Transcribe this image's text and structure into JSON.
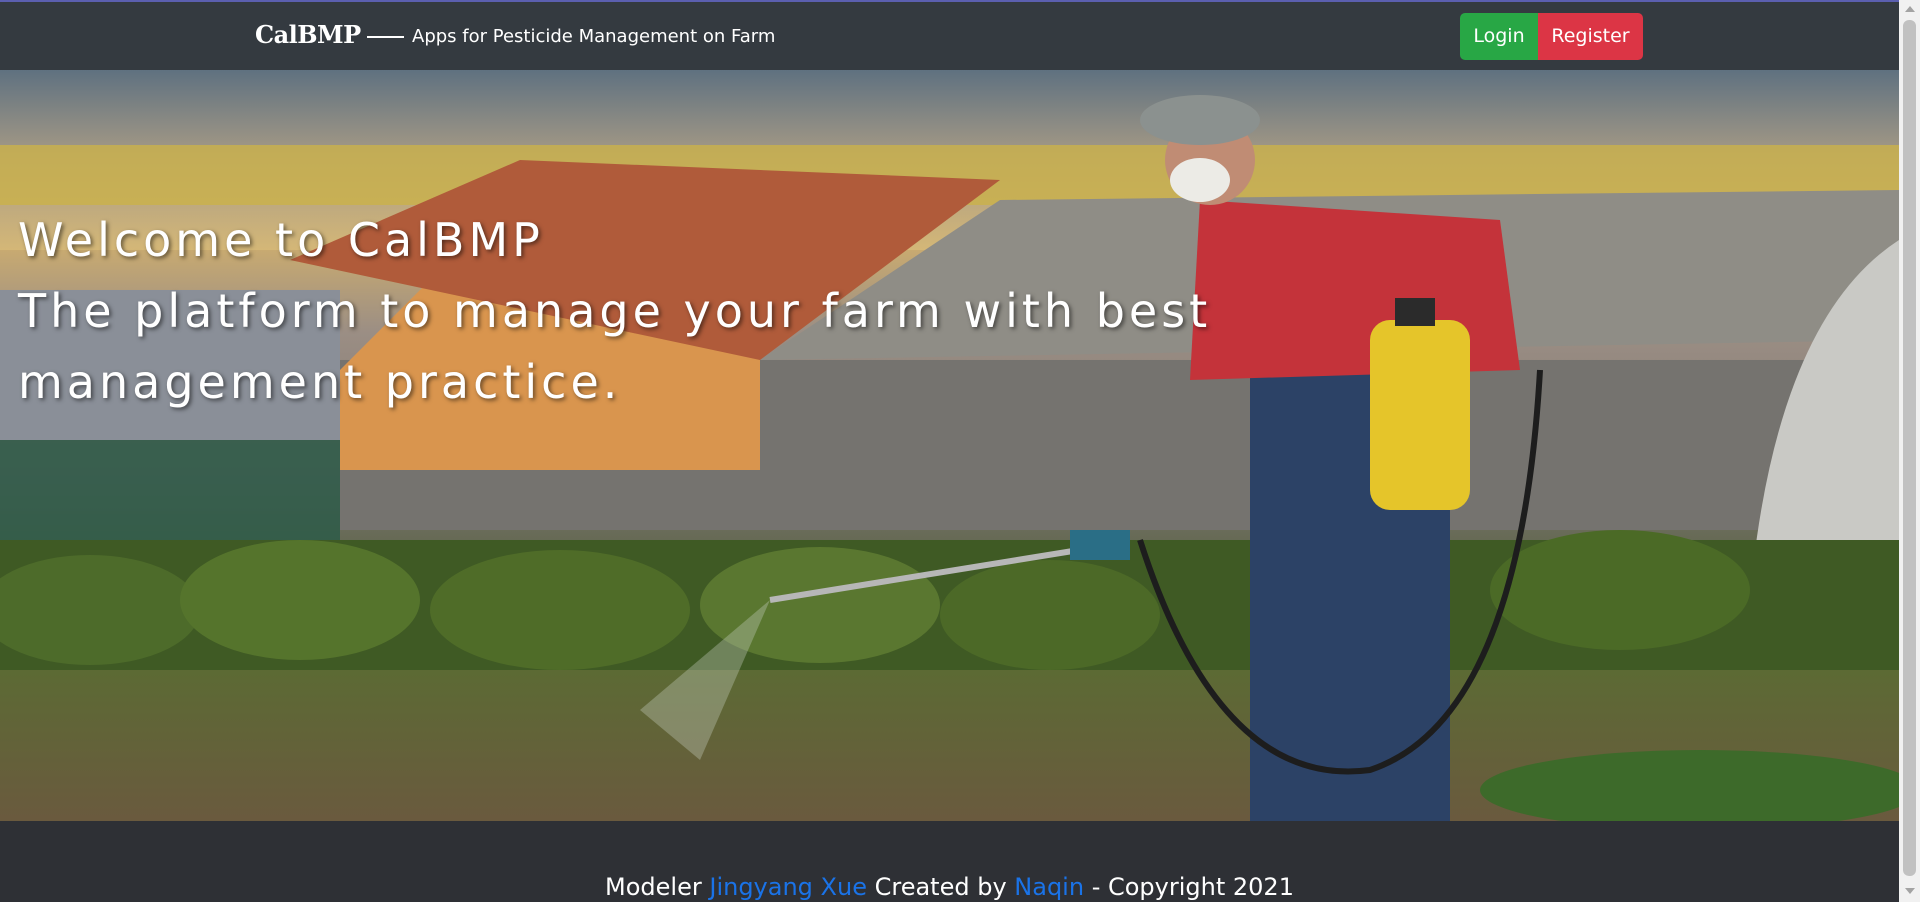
{
  "header": {
    "brand": "CalBMP",
    "tagline": "Apps for Pesticide Management on Farm",
    "login_label": "Login",
    "register_label": "Register"
  },
  "hero": {
    "line1": "Welcome to CalBMP",
    "line2": "The platform to manage your farm with best",
    "line3": "management practice."
  },
  "footer": {
    "modeler_prefix": "Modeler",
    "modeler_name": "Jingyang Xue",
    "created_prefix": "Created by",
    "creator_name": "Naqin",
    "copyright": "- Copyright 2021"
  },
  "colors": {
    "navbar": "#343a40",
    "login": "#28a745",
    "register": "#dc3545",
    "link": "#1a73e8",
    "footer": "#2e3035"
  }
}
